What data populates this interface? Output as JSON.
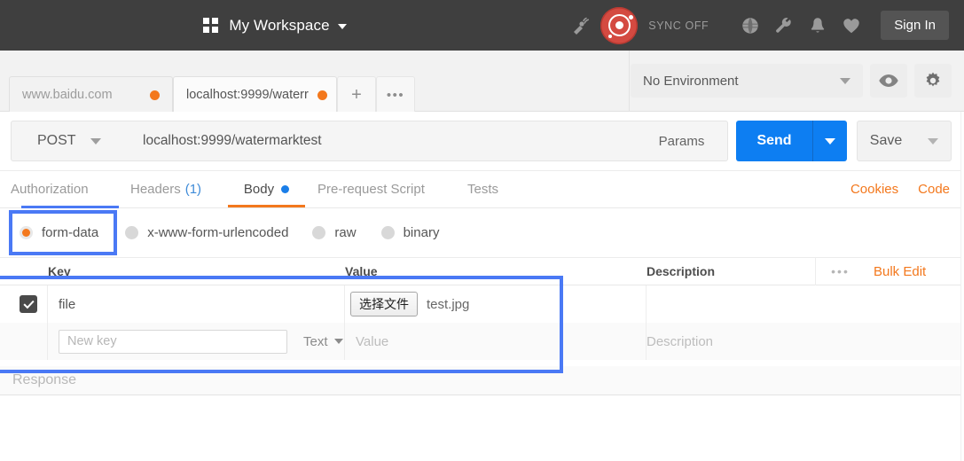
{
  "header": {
    "workspace_title": "My Workspace",
    "grid_icon": "grid-icon",
    "caret_icon": "caret-down-icon",
    "interceptor_icon": "satellite-dish-icon",
    "logo_icon": "postman-logo-icon",
    "sync_status": "SYNC OFF",
    "globe_icon": "globe-icon",
    "wrench_icon": "wrench-icon",
    "bell_icon": "bell-icon",
    "heart_icon": "heart-icon",
    "signin_label": "Sign In"
  },
  "tabstrip": {
    "tabs": [
      {
        "label": "www.baidu.com",
        "active": false,
        "unsaved": true
      },
      {
        "label": "localhost:9999/waterr",
        "active": true,
        "unsaved": true
      }
    ],
    "new_tab_label": "+",
    "more_tabs_label": "•••",
    "environment": {
      "selected": "No Environment",
      "chevron_icon": "chevron-down-icon"
    },
    "eye_icon": "eye-icon",
    "gear_icon": "gear-icon"
  },
  "request": {
    "method": "POST",
    "method_caret_icon": "chevron-down-icon",
    "url": "localhost:9999/watermarktest",
    "params_label": "Params",
    "send_label": "Send",
    "send_caret_icon": "chevron-down-icon",
    "save_label": "Save",
    "save_caret_icon": "chevron-down-icon"
  },
  "request_tabs": {
    "items": [
      {
        "label": "Authorization",
        "active": false
      },
      {
        "label": "Headers",
        "count": "(1)",
        "active": false
      },
      {
        "label": "Body",
        "active": true,
        "dot": true
      },
      {
        "label": "Pre-request Script",
        "active": false
      },
      {
        "label": "Tests",
        "active": false
      }
    ],
    "cookies_label": "Cookies",
    "code_label": "Code"
  },
  "body_types": {
    "options": [
      {
        "label": "form-data",
        "selected": true
      },
      {
        "label": "x-www-form-urlencoded",
        "selected": false
      },
      {
        "label": "raw",
        "selected": false
      },
      {
        "label": "binary",
        "selected": false
      }
    ]
  },
  "kv_table": {
    "headers": {
      "key": "Key",
      "value": "Value",
      "description": "Description"
    },
    "more_icon": "ellipsis-icon",
    "bulk_edit_label": "Bulk Edit",
    "rows": [
      {
        "checked": true,
        "key": "file",
        "choose_file_label": "选择文件",
        "file_name": "test.jpg",
        "description": ""
      },
      {
        "checked": false,
        "key_placeholder": "New key",
        "type_label": "Text",
        "type_caret_icon": "caret-down-icon",
        "value_placeholder": "Value",
        "description_placeholder": "Description"
      }
    ]
  },
  "response": {
    "label": "Response"
  },
  "colors": {
    "header_bg": "#3f3f3f",
    "accent_orange": "#f3781d",
    "send_blue": "#0d7ef2",
    "annotation_blue": "#4a79f5",
    "logo_red": "#d44a41",
    "body_dot_blue": "#1a7ee8"
  }
}
